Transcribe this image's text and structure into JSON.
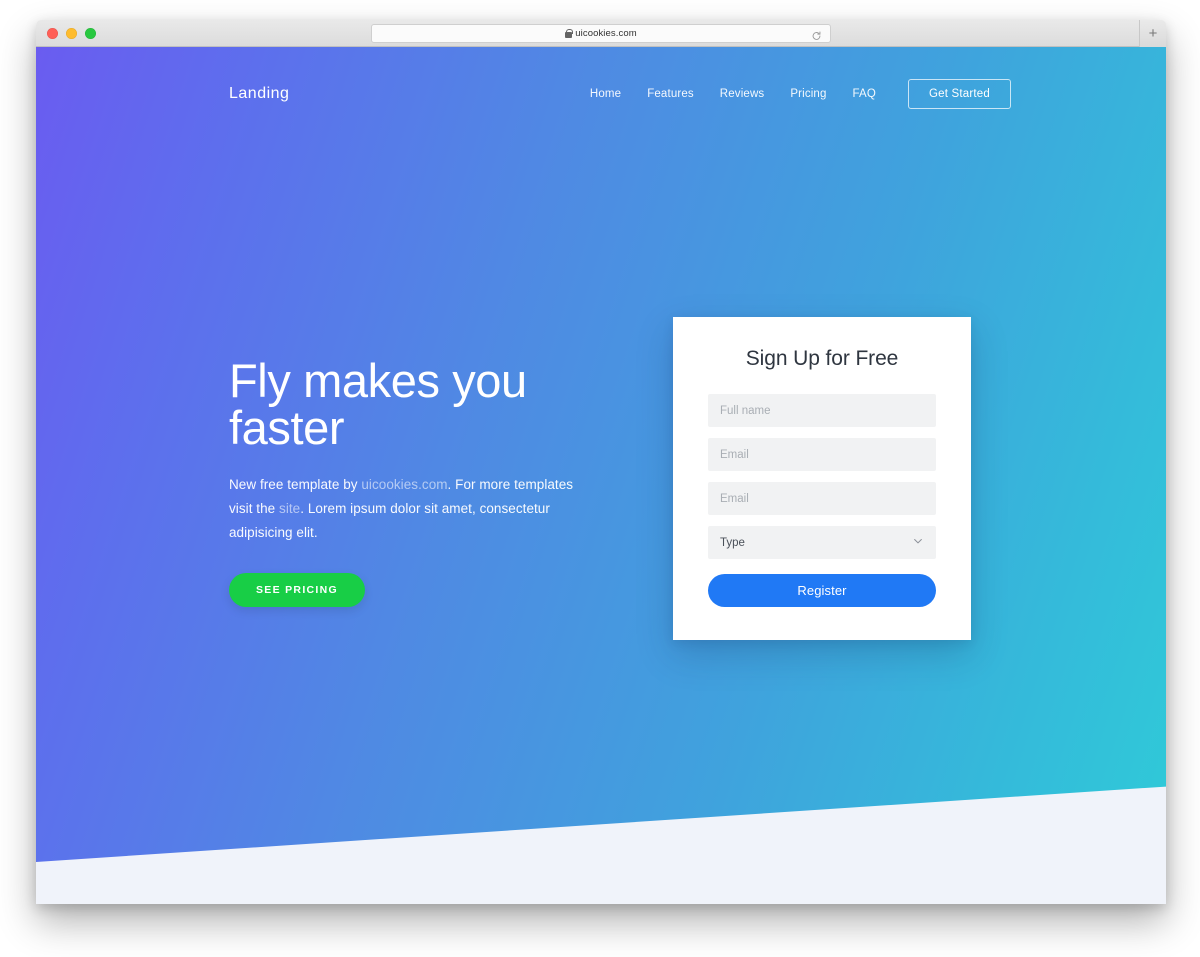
{
  "browser": {
    "url": "uicookies.com",
    "lock_icon": "lock-icon",
    "reload_icon": "reload-icon",
    "newtab_label": "+",
    "traffic_lights": [
      "close-red",
      "minimize-yellow",
      "maximize-green"
    ]
  },
  "nav": {
    "brand": "Landing",
    "links": [
      {
        "label": "Home"
      },
      {
        "label": "Features"
      },
      {
        "label": "Reviews"
      },
      {
        "label": "Pricing"
      },
      {
        "label": "FAQ"
      }
    ],
    "cta_label": "Get Started"
  },
  "hero": {
    "title": "Fly makes you\nfaster",
    "paragraph_part1": "New free template by ",
    "link1": "uicookies.com",
    "paragraph_part2": ". For more templates visit the ",
    "link2": "site",
    "paragraph_part3": ". Lorem ipsum dolor sit amet, consectetur adipisicing elit.",
    "cta_label": "SEE PRICING"
  },
  "signup": {
    "title": "Sign Up for Free",
    "fields": [
      {
        "name": "full-name",
        "placeholder": "Full name",
        "value": ""
      },
      {
        "name": "email",
        "placeholder": "Email",
        "value": ""
      },
      {
        "name": "email-confirm",
        "placeholder": "Email",
        "value": ""
      }
    ],
    "select": {
      "label": "Type",
      "icon": "chevron-down-icon",
      "options": [
        "Type"
      ]
    },
    "submit_label": "Register"
  },
  "colors": {
    "gradient_start": "#6a5cf0",
    "gradient_end": "#2fcbd8",
    "green_cta": "#18ce46",
    "blue_cta": "#2079f5",
    "section_bg": "#f0f3fa",
    "field_bg": "#f1f2f3"
  }
}
